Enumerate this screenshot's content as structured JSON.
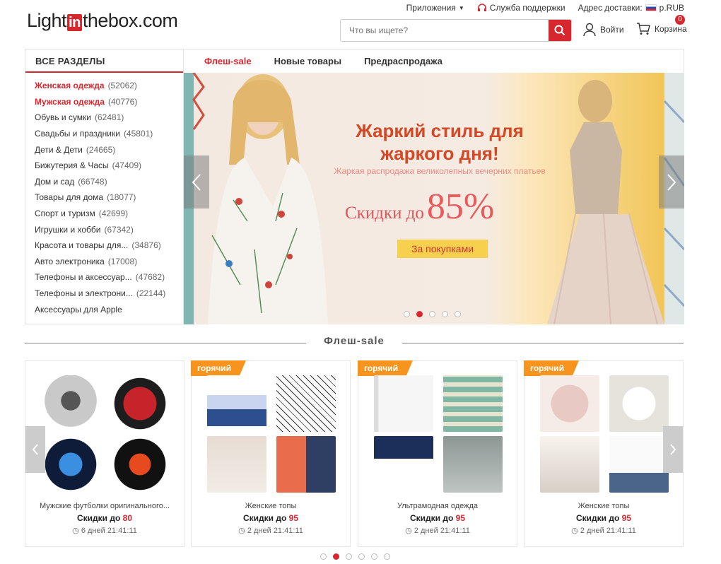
{
  "logo": {
    "part1": "Light",
    "part2": "in",
    "part3": "thebox.com"
  },
  "toplinks": {
    "apps": "Приложения",
    "support": "Служба поддержки",
    "delivery": "Адрес доставки:",
    "currency": "р.RUB"
  },
  "search": {
    "placeholder": "Что вы ищете?"
  },
  "account": {
    "login": "Войти",
    "cart": "Корзина",
    "cart_count": "0"
  },
  "categories": {
    "title": "ВСЕ РАЗДЕЛЫ",
    "items": [
      {
        "label": "Женская одежда",
        "count": "(52062)"
      },
      {
        "label": "Мужская одежда",
        "count": "(40776)"
      },
      {
        "label": "Обувь и сумки",
        "count": "(62481)"
      },
      {
        "label": "Свадьбы и праздники",
        "count": "(45801)"
      },
      {
        "label": "Дети & Дети",
        "count": "(24665)"
      },
      {
        "label": "Бижутерия & Часы",
        "count": "(47409)"
      },
      {
        "label": "Дом и сад",
        "count": "(66748)"
      },
      {
        "label": "Товары для дома",
        "count": "(18077)"
      },
      {
        "label": "Спорт и туризм",
        "count": "(42699)"
      },
      {
        "label": "Игрушки и хобби",
        "count": "(67342)"
      },
      {
        "label": "Красота и товары для...",
        "count": "(34876)"
      },
      {
        "label": "Авто электроника",
        "count": "(17008)"
      },
      {
        "label": "Телефоны и аксессуар...",
        "count": "(47682)"
      },
      {
        "label": "Телефоны и электрони...",
        "count": "(22144)"
      },
      {
        "label": "Аксессуары для Apple",
        "count": ""
      }
    ]
  },
  "tabs": [
    "Флеш-sale",
    "Новые товары",
    "Предраспродажа"
  ],
  "banner": {
    "title": "Жаркий стиль для жаркого дня!",
    "subtitle": "Жаркая распродажа великолепных вечерних платьев",
    "discount_prefix": "Скидки до",
    "discount_value": "85%",
    "cta": "За покупками"
  },
  "flash": {
    "title": "Флеш-sale",
    "hot_label": "горячий",
    "cards": [
      {
        "name": "Мужские футболки оригинального...",
        "price_prefix": "Скидки до",
        "price": "80",
        "timer": "6 дней 21:41:11"
      },
      {
        "name": "Женские топы",
        "price_prefix": "Скидки до",
        "price": "95",
        "timer": "2 дней 21:41:11"
      },
      {
        "name": "Ультрамодная одежда",
        "price_prefix": "Скидки до",
        "price": "95",
        "timer": "2 дней 21:41:11"
      },
      {
        "name": "Женские топы",
        "price_prefix": "Скидки до",
        "price": "95",
        "timer": "2 дней 21:41:11"
      }
    ]
  },
  "colors": {
    "accent": "#d8262e",
    "hot": "#f7941d"
  }
}
